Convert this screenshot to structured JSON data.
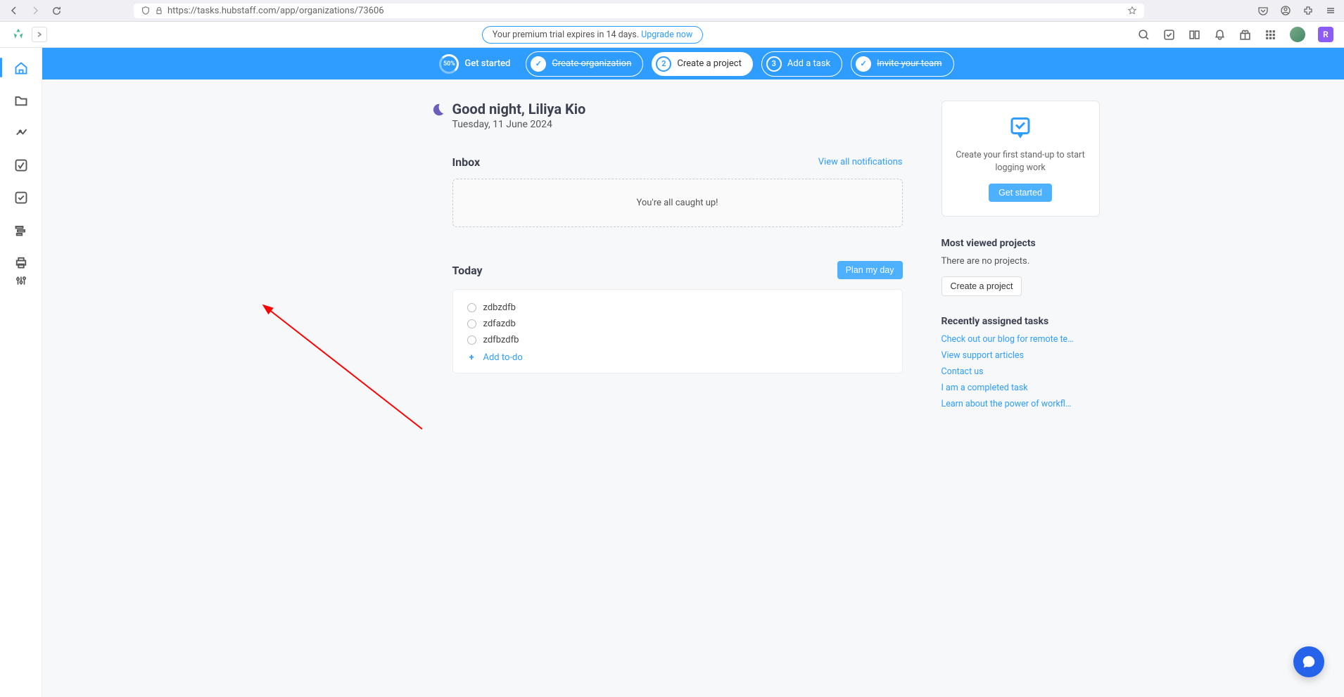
{
  "browser": {
    "url": "https://tasks.hubstaff.com/app/organizations/73606"
  },
  "trial": {
    "text": "Your premium trial expires in 14 days.",
    "link": "Upgrade now"
  },
  "user_badge": "R",
  "onboarding": {
    "percent": "50%",
    "get_started": "Get started",
    "steps": [
      {
        "label": "Create organization",
        "done": true
      },
      {
        "label": "Create a project",
        "num": "2"
      },
      {
        "label": "Add a task",
        "num": "3"
      },
      {
        "label": "Invite your team",
        "done": true
      }
    ]
  },
  "greeting": {
    "title": "Good night, Liliya Kio",
    "date": "Tuesday, 11 June 2024"
  },
  "inbox": {
    "header": "Inbox",
    "view_all": "View all notifications",
    "empty": "You're all caught up!"
  },
  "today": {
    "header": "Today",
    "plan_btn": "Plan my day",
    "tasks": [
      "zdbzdfb",
      "zdfazdb",
      "zdfbzdfb"
    ],
    "add": "Add to-do"
  },
  "standup": {
    "text": "Create your first stand-up to start logging work",
    "btn": "Get started"
  },
  "projects": {
    "header": "Most viewed projects",
    "empty": "There are no projects.",
    "create": "Create a project"
  },
  "recent": {
    "header": "Recently assigned tasks",
    "links": [
      "Check out our blog for remote tea…",
      "View support articles",
      "Contact us",
      "I am a completed task",
      "Learn about the power of workflows"
    ]
  }
}
